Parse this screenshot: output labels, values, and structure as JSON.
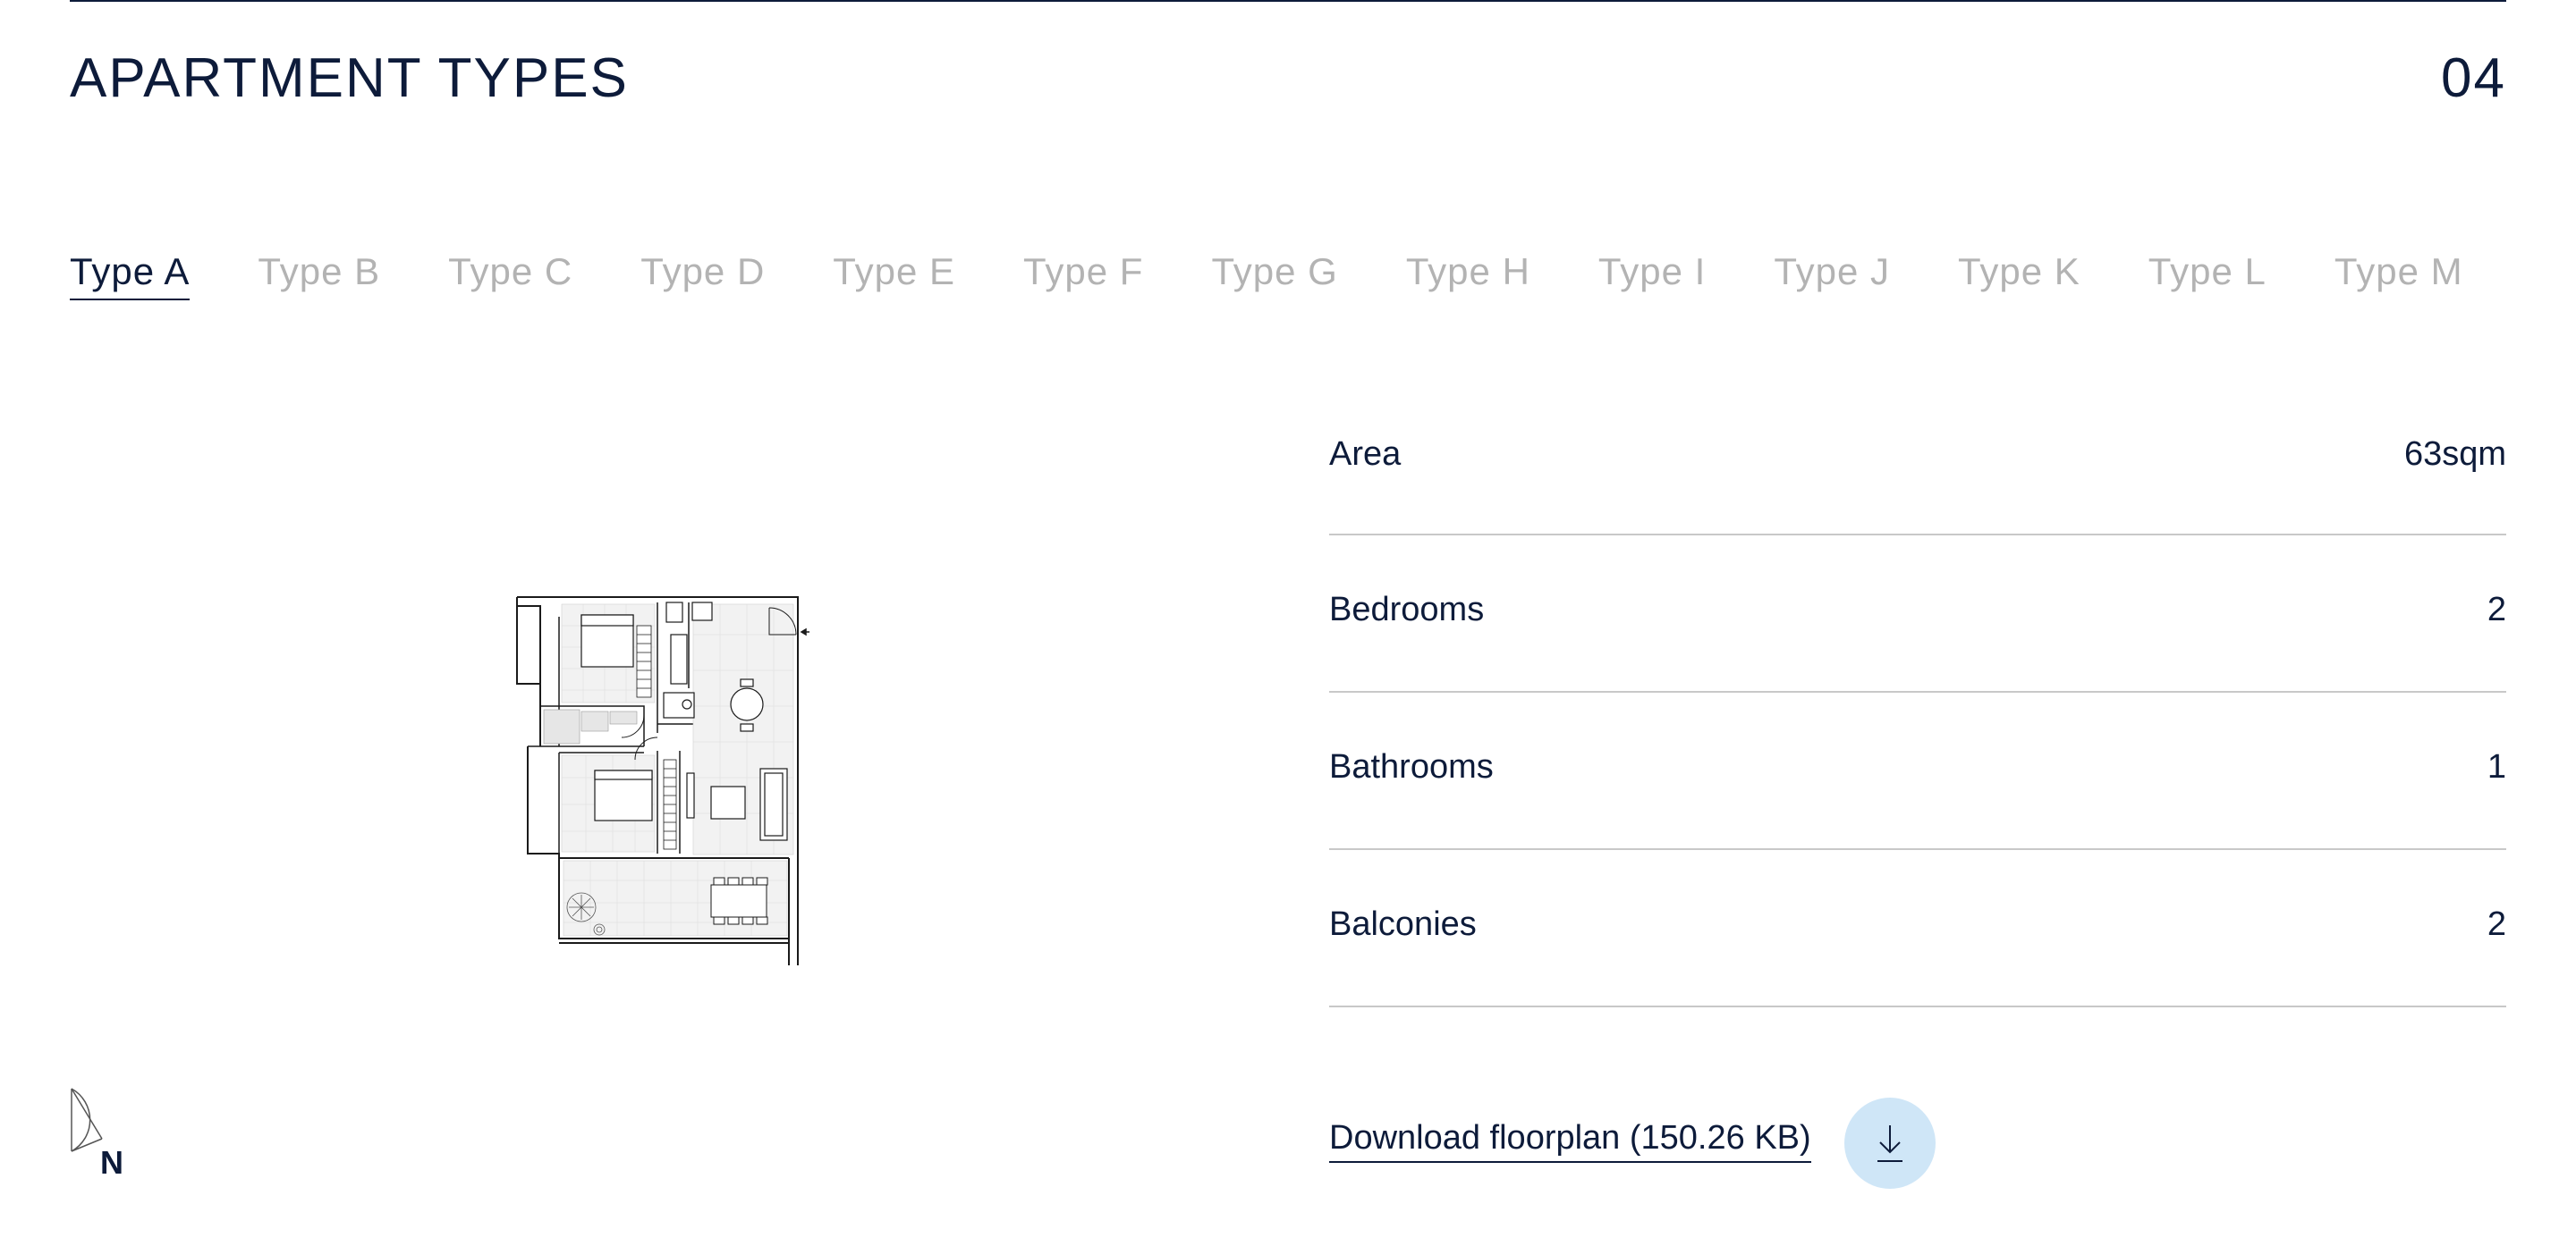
{
  "section": {
    "title": "APARTMENT TYPES",
    "number": "04"
  },
  "tabs": [
    {
      "label": "Type A",
      "active": true
    },
    {
      "label": "Type B",
      "active": false
    },
    {
      "label": "Type C",
      "active": false
    },
    {
      "label": "Type D",
      "active": false
    },
    {
      "label": "Type E",
      "active": false
    },
    {
      "label": "Type F",
      "active": false
    },
    {
      "label": "Type G",
      "active": false
    },
    {
      "label": "Type H",
      "active": false
    },
    {
      "label": "Type I",
      "active": false
    },
    {
      "label": "Type J",
      "active": false
    },
    {
      "label": "Type K",
      "active": false
    },
    {
      "label": "Type L",
      "active": false
    },
    {
      "label": "Type M",
      "active": false
    }
  ],
  "specs": [
    {
      "label": "Area",
      "value": "63sqm"
    },
    {
      "label": "Bedrooms",
      "value": "2"
    },
    {
      "label": "Bathrooms",
      "value": "1"
    },
    {
      "label": "Balconies",
      "value": "2"
    }
  ],
  "download": {
    "label": "Download floorplan (150.26 KB)",
    "icon": "download-arrow-icon"
  },
  "compass": {
    "label": "N",
    "icon": "north-compass-icon"
  },
  "floorplan": {
    "icon": "floorplan-drawing"
  },
  "colors": {
    "text": "#0d1b3a",
    "inactive_tab": "#b3b3b3",
    "divider": "#c8c8c8",
    "download_circle": "#cfe6f7"
  }
}
